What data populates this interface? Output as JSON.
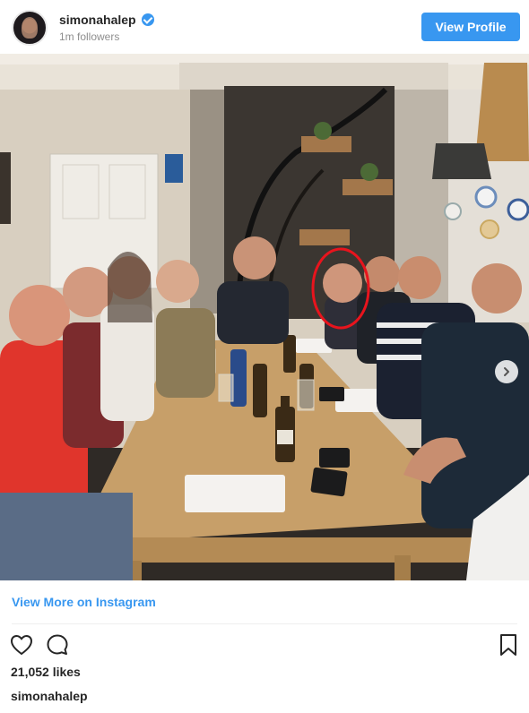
{
  "header": {
    "username": "simonahalep",
    "followers": "1m followers",
    "view_profile_label": "View Profile"
  },
  "photo": {
    "description": "group-dinner-photo",
    "highlight_color": "#e8141d"
  },
  "footer": {
    "view_more_label": "View More on Instagram",
    "likes": "21,052 likes",
    "caption_username": "simonahalep"
  },
  "icons": {
    "like": "heart-icon",
    "comment": "comment-icon",
    "save": "bookmark-icon",
    "verified": "verified-badge-icon",
    "next": "chevron-right-icon"
  },
  "colors": {
    "accent": "#3897f0",
    "text": "#262626",
    "muted": "#8e8e8e"
  }
}
